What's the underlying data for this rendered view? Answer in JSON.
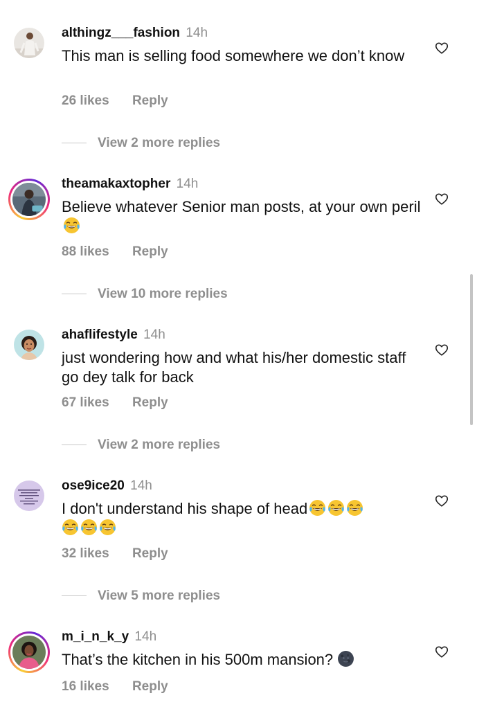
{
  "comments": [
    {
      "username": "althingz___fashion",
      "time": "14h",
      "text": "This man is selling food somewhere we don’t know",
      "likes": "26 likes",
      "reply": "Reply",
      "view_more": "View 2 more replies"
    },
    {
      "username": "theamakaxtopher",
      "time": "14h",
      "text": "Believe whatever Senior man posts, at your own peril",
      "likes": "88 likes",
      "reply": "Reply",
      "view_more": "View 10 more replies"
    },
    {
      "username": "ahaflifestyle",
      "time": "14h",
      "text": "just wondering how and what his/her domestic staff go dey talk for back",
      "likes": "67 likes",
      "reply": "Reply",
      "view_more": "View 2 more replies"
    },
    {
      "username": "ose9ice20",
      "time": "14h",
      "text_line1": "I don't understand his shape of head",
      "likes": "32 likes",
      "reply": "Reply",
      "view_more": "View 5 more replies"
    },
    {
      "username": "m_i_n_k_y",
      "time": "14h",
      "text": "That’s the kitchen in his 500m mansion?",
      "likes": "16 likes",
      "reply": "Reply"
    }
  ],
  "icons": {
    "heart": "heart-outline-icon",
    "laughing": "face-with-tears-of-joy-emoji",
    "moon": "new-moon-face-emoji"
  },
  "colors": {
    "secondary_text": "#8e8e8e",
    "story_ring_start": "#f9ce34",
    "story_ring_mid": "#ee2a7b",
    "story_ring_end": "#6228d7"
  }
}
